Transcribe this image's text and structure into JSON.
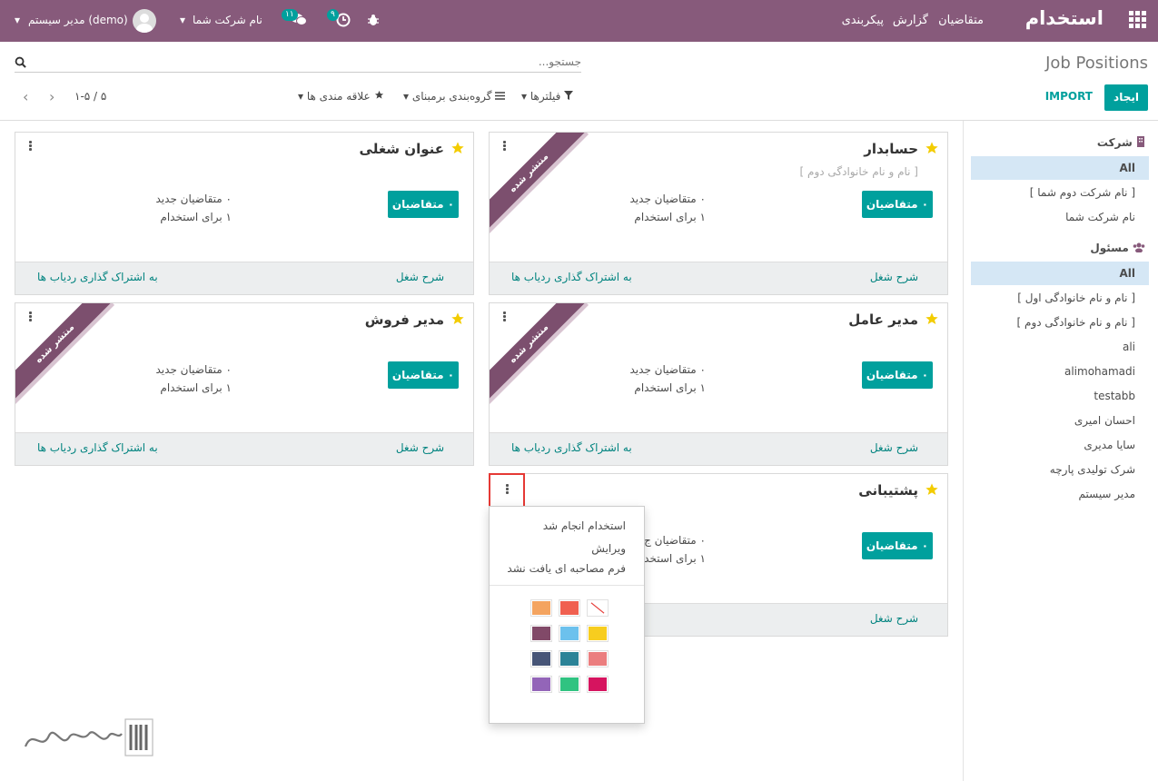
{
  "navbar": {
    "brand": "استخدام",
    "menu": [
      "متقاضیان",
      "گزارش",
      "پیکربندی"
    ],
    "user": "مدیر سیستم (demo)",
    "company": "نام شرکت شما",
    "messages_count": "۱۱",
    "activities_count": "۹"
  },
  "control_panel": {
    "breadcrumb": "Job Positions",
    "search_placeholder": "جستجو...",
    "create_label": "ایجاد",
    "import_label": "IMPORT",
    "filters_label": "فیلترها",
    "groupby_label": "گروه‌بندی برمبنای",
    "favorites_label": "علاقه مندی ها",
    "pager": "۱-۵ / ۵"
  },
  "sidepanel": {
    "company_header": "شرکت",
    "company_items": [
      {
        "label": "All",
        "active": true
      },
      {
        "label": "[ نام شرکت دوم شما ]",
        "active": false
      },
      {
        "label": "نام شرکت شما",
        "active": false
      }
    ],
    "responsible_header": "مسئول",
    "responsible_items": [
      {
        "label": "All",
        "active": true
      },
      {
        "label": "[ نام و نام خانوادگی اول ]",
        "active": false
      },
      {
        "label": "[ نام و نام خانوادگی دوم ]",
        "active": false
      },
      {
        "label": "ali",
        "active": false
      },
      {
        "label": "alimohamadi",
        "active": false
      },
      {
        "label": "testabb",
        "active": false
      },
      {
        "label": "احسان امیری",
        "active": false
      },
      {
        "label": "سایا مدیری",
        "active": false
      },
      {
        "label": "شرک تولیدی پارچه",
        "active": false
      },
      {
        "label": "مدیر سیستم",
        "active": false
      }
    ]
  },
  "cards": [
    {
      "title": "حسابدار",
      "subtitle": "[ نام و نام خانوادگی دوم ]",
      "button": "۰ متقاضیان",
      "new_applicants": "۰ متقاضیان جدید",
      "to_recruit": "۱ برای استخدام",
      "job_desc": "شرح شغل",
      "share": "به اشتراک گذاری ردیاب ها",
      "ribbon": "منتشر شده"
    },
    {
      "title": "عنوان شغلی",
      "subtitle": "",
      "button": "۰ متقاضیان",
      "new_applicants": "۰ متقاضیان جدید",
      "to_recruit": "۱ برای استخدام",
      "job_desc": "شرح شغل",
      "share": "به اشتراک گذاری ردیاب ها",
      "ribbon": ""
    },
    {
      "title": "مدیر عامل",
      "subtitle": "",
      "button": "۰ متقاضیان",
      "new_applicants": "۰ متقاضیان جدید",
      "to_recruit": "۱ برای استخدام",
      "job_desc": "شرح شغل",
      "share": "به اشتراک گذاری ردیاب ها",
      "ribbon": "منتشر شده"
    },
    {
      "title": "مدیر فروش",
      "subtitle": "",
      "button": "۰ متقاضیان",
      "new_applicants": "۰ متقاضیان جدید",
      "to_recruit": "۱ برای استخدام",
      "job_desc": "شرح شغل",
      "share": "به اشتراک گذاری ردیاب ها",
      "ribbon": "منتشر شده"
    },
    {
      "title": "پشتیبانی",
      "subtitle": "",
      "button": "۰ متقاضیان",
      "new_applicants": "۰ متقاضیان ج",
      "to_recruit": "۱ برای استخد",
      "job_desc": "شرح شغل",
      "share": "",
      "ribbon": ""
    }
  ],
  "dropdown": {
    "items": [
      "استخدام انجام شد",
      "ویرایش",
      "فرم مصاحبه ای یافت نشد"
    ],
    "colors": [
      "none",
      "#f06050",
      "#f4a460",
      "#f7cd1f",
      "#6cc1ed",
      "#814968",
      "#eb7e7f",
      "#2c8397",
      "#475577",
      "#d6145f",
      "#30c381",
      "#9365b8"
    ]
  },
  "colors": {
    "brand": "#875a7b",
    "accent": "#00a09d",
    "ribbon": "#7c4f6e",
    "star": "#f3cc00"
  }
}
